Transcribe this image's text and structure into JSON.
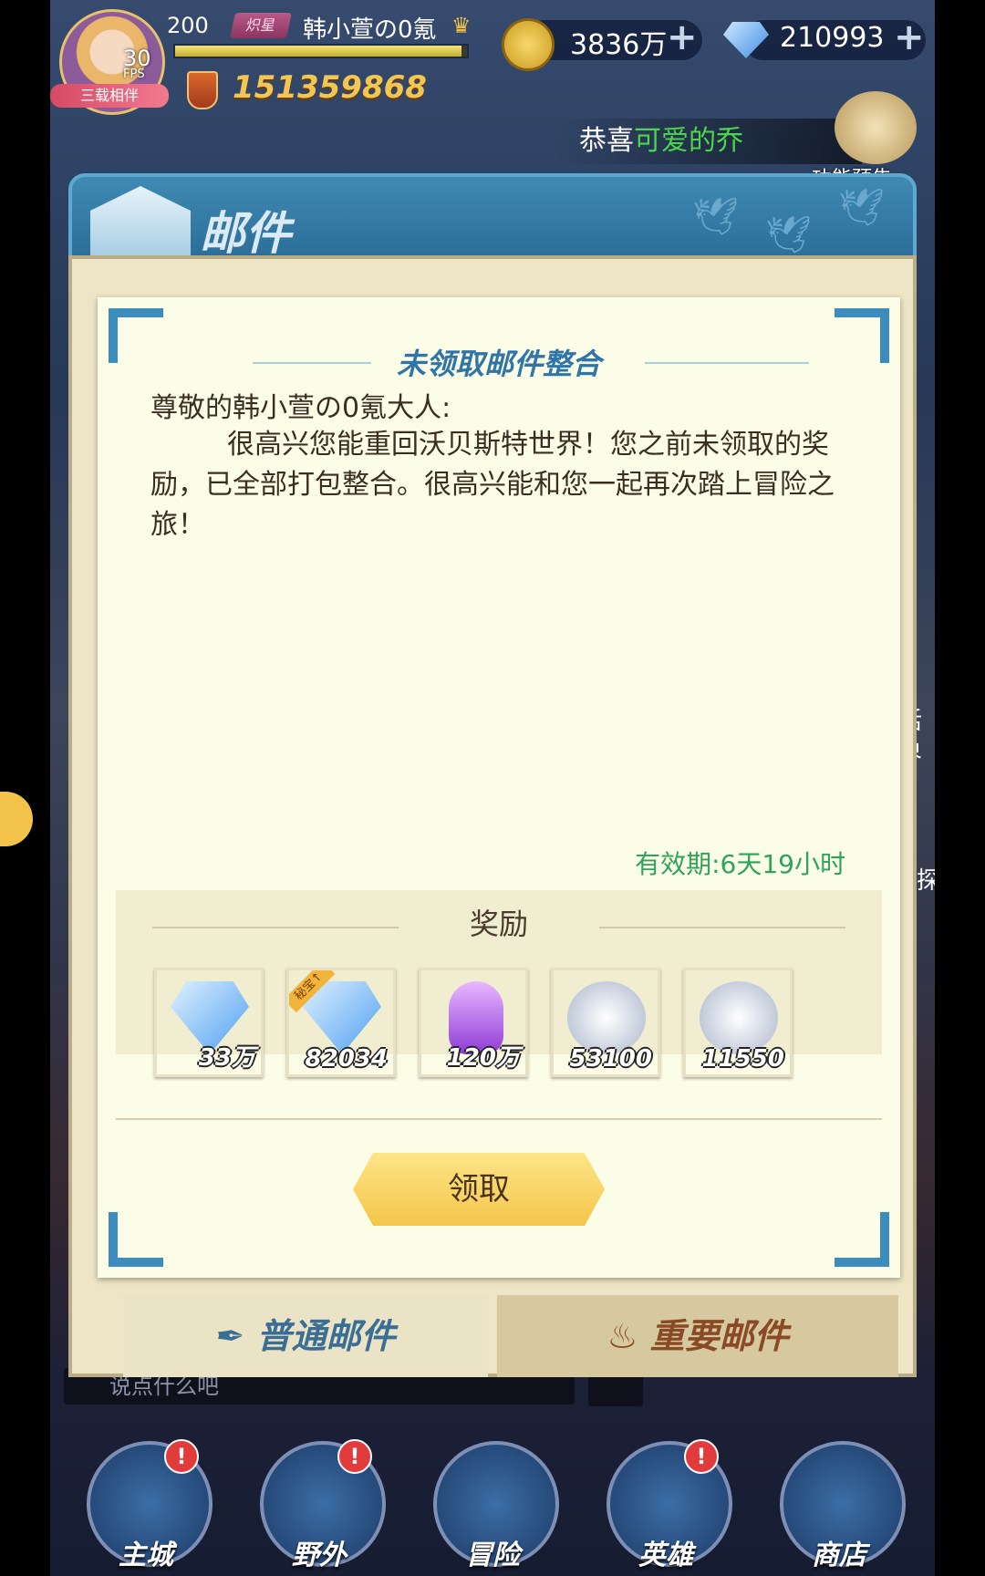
{
  "player": {
    "level": "200",
    "vip": "炽星",
    "name": "韩小萱の0氪",
    "power": "151359868",
    "avatar_tag": "三载相伴",
    "fps_value": "30",
    "fps_label": "FPS",
    "exp_fraction": 0.98
  },
  "currency": {
    "gold": "3836万",
    "diamond": "210993",
    "plus": "+"
  },
  "marquee": {
    "prefix": "恭喜",
    "highlight": "可爱的乔"
  },
  "preview_label": "功能预告",
  "side_texts": {
    "right1": "活界",
    "right2": "探"
  },
  "dialog": {
    "title": "邮件",
    "mail_title": "未领取邮件整合",
    "greeting": "尊敬的韩小萱の0氪大人:",
    "body": "很高兴您能重回沃贝斯特世界！您之前未领取的奖励，已全部打包整合。很高兴能和您一起再次踏上冒险之旅！",
    "validity": "有效期:6天19小时",
    "reward_title": "奖励",
    "claim_button": "领取",
    "rewards": [
      {
        "name": "diamond",
        "count": "33万",
        "bg": "#3a7bd5",
        "tag": ""
      },
      {
        "name": "diamond-secret",
        "count": "82034",
        "bg": "#3a7bd5",
        "tag": "秘宝↑"
      },
      {
        "name": "potion",
        "count": "120万",
        "bg": "#6a3fb0",
        "tag": ""
      },
      {
        "name": "sword-medal",
        "count": "53100",
        "bg": "#6a3fb0",
        "tag": ""
      },
      {
        "name": "sword-badge",
        "count": "11550",
        "bg": "#6a3fb0",
        "tag": ""
      }
    ],
    "tabs": [
      {
        "label": "普通邮件",
        "icon": "feather-icon"
      },
      {
        "label": "重要邮件",
        "icon": "balloon-icon"
      }
    ]
  },
  "chat_placeholder": "说点什么吧",
  "bottom_nav": [
    {
      "label": "主城",
      "badge": "!"
    },
    {
      "label": "野外",
      "badge": "!"
    },
    {
      "label": "冒险",
      "badge": ""
    },
    {
      "label": "英雄",
      "badge": "!"
    },
    {
      "label": "商店",
      "badge": ""
    }
  ],
  "colors": {
    "accent_blue": "#2f75a8",
    "valid_green": "#2fa35a",
    "gold": "#f3c654",
    "claim_yellow": "#f4c64a"
  }
}
